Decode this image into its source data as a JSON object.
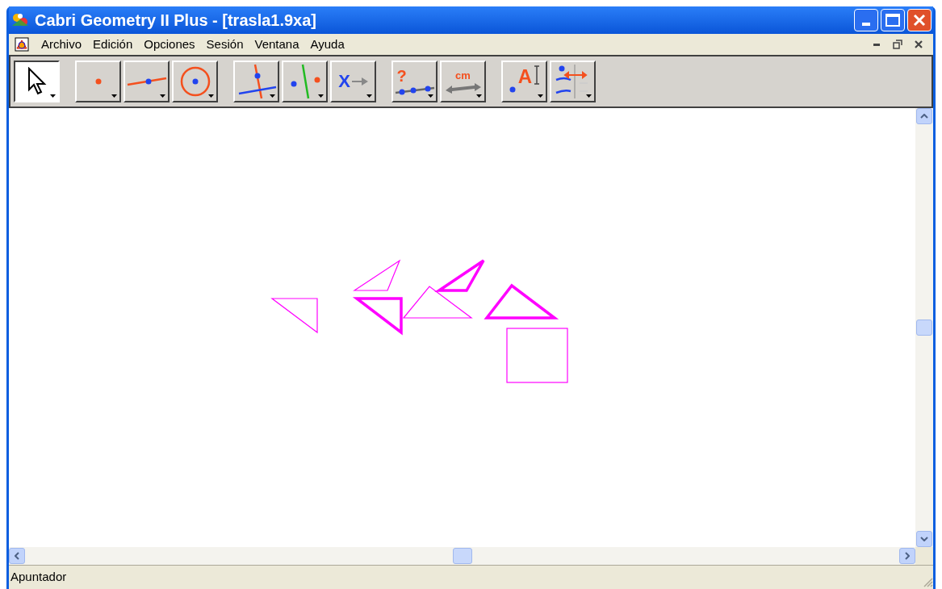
{
  "window": {
    "title": "Cabri Geometry II Plus - [trasla1.9xa]"
  },
  "menu": [
    "Archivo",
    "Edición",
    "Opciones",
    "Sesión",
    "Ventana",
    "Ayuda"
  ],
  "toolbar": {
    "groups": [
      [
        {
          "kind": "pointer",
          "selected": true
        }
      ],
      [
        {
          "kind": "point",
          "selected": false
        },
        {
          "kind": "line",
          "selected": false
        },
        {
          "kind": "circle",
          "selected": false
        }
      ],
      [
        {
          "kind": "perpendicular",
          "selected": false
        },
        {
          "kind": "symmetry",
          "selected": false
        },
        {
          "kind": "macro",
          "glyph": "X",
          "selected": false
        }
      ],
      [
        {
          "kind": "check",
          "glyph": "?",
          "selected": false
        },
        {
          "kind": "measure",
          "glyph": "cm",
          "selected": false
        }
      ],
      [
        {
          "kind": "label",
          "glyph": "A",
          "selected": false
        },
        {
          "kind": "attributes",
          "selected": false
        }
      ]
    ]
  },
  "canvas": {
    "shapes": [
      {
        "kind": "triangle",
        "thick": false
      },
      {
        "kind": "triangle",
        "thick": false
      },
      {
        "kind": "triangle",
        "thick": true
      },
      {
        "kind": "triangle",
        "thick": false
      },
      {
        "kind": "triangle",
        "thick": true
      },
      {
        "kind": "triangle",
        "thick": true
      },
      {
        "kind": "square",
        "thick": false
      }
    ]
  },
  "status_bar": {
    "text": "Apuntador"
  }
}
